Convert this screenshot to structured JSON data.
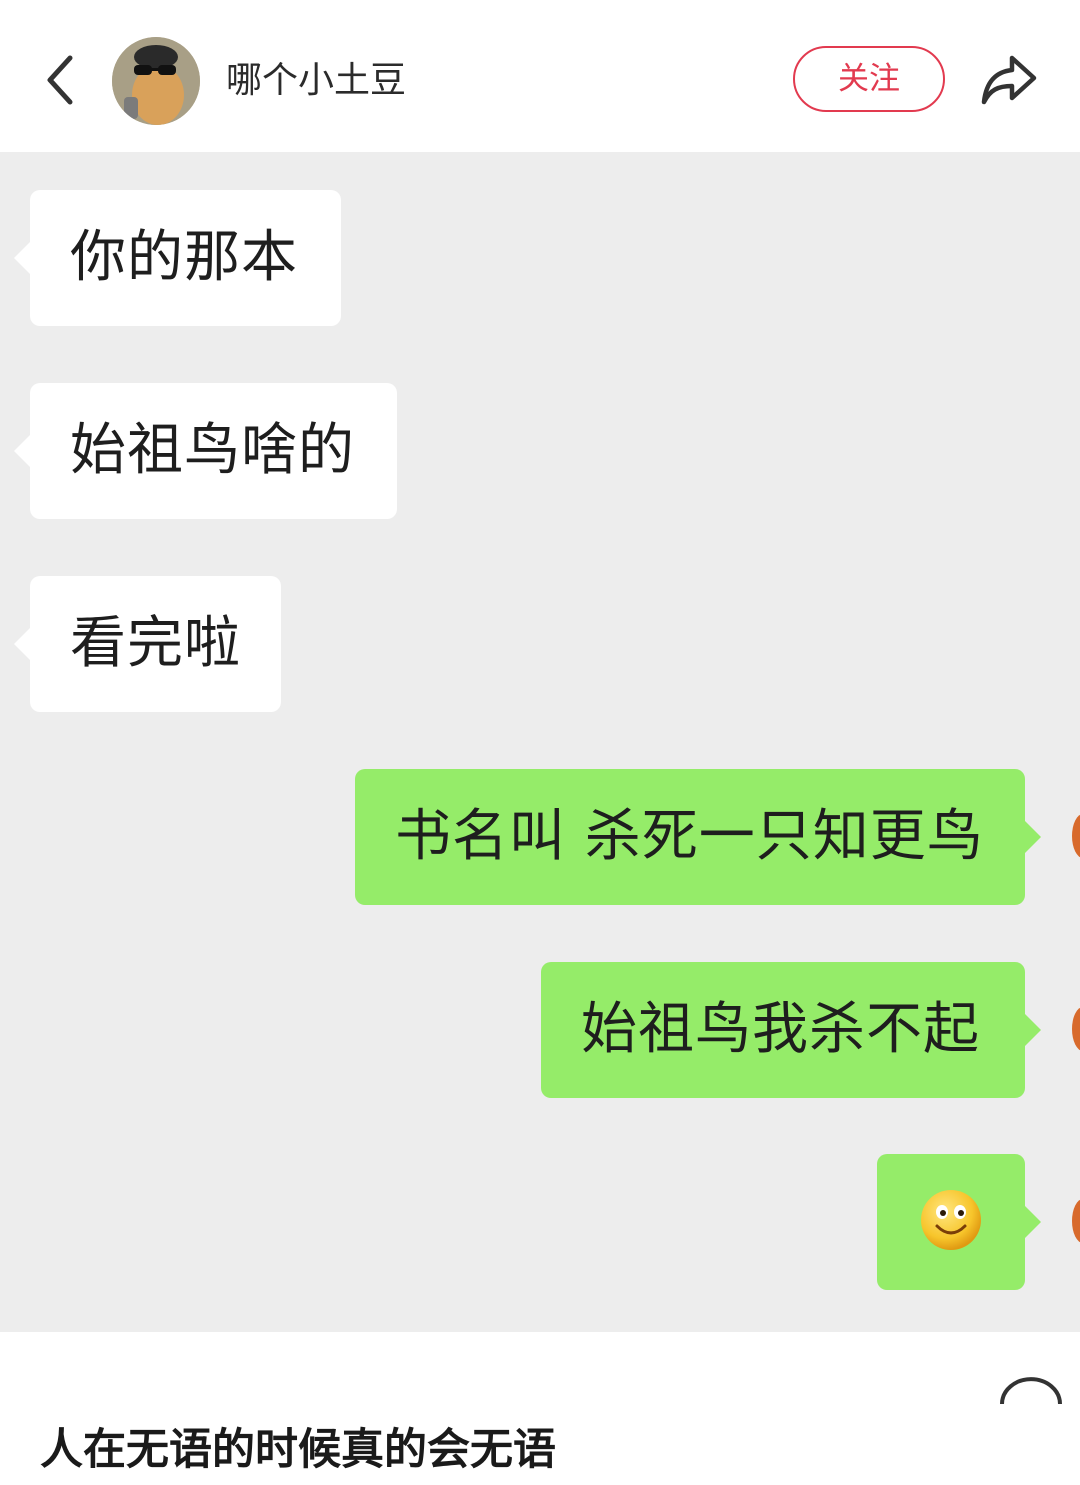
{
  "header": {
    "back_icon": "chevron-left-icon",
    "avatar_icon": "avatar-image",
    "author_name": "哪个小土豆",
    "follow_label": "关注",
    "share_icon": "share-arrow-icon"
  },
  "chat": {
    "incoming": [
      {
        "text": "你的那本"
      },
      {
        "text": "始祖鸟啥的"
      },
      {
        "text": "看完啦"
      }
    ],
    "outgoing": [
      {
        "text": "书名叫 杀死一只知更鸟"
      },
      {
        "text": "始祖鸟我杀不起"
      },
      {
        "emoji": "smiley-emoji-icon"
      }
    ],
    "colors": {
      "background": "#ededed",
      "incoming_bubble": "#ffffff",
      "outgoing_bubble": "#95ec69"
    }
  },
  "post": {
    "caption": "人在无语的时候真的会无语"
  },
  "colors": {
    "accent": "#e23a4f"
  }
}
